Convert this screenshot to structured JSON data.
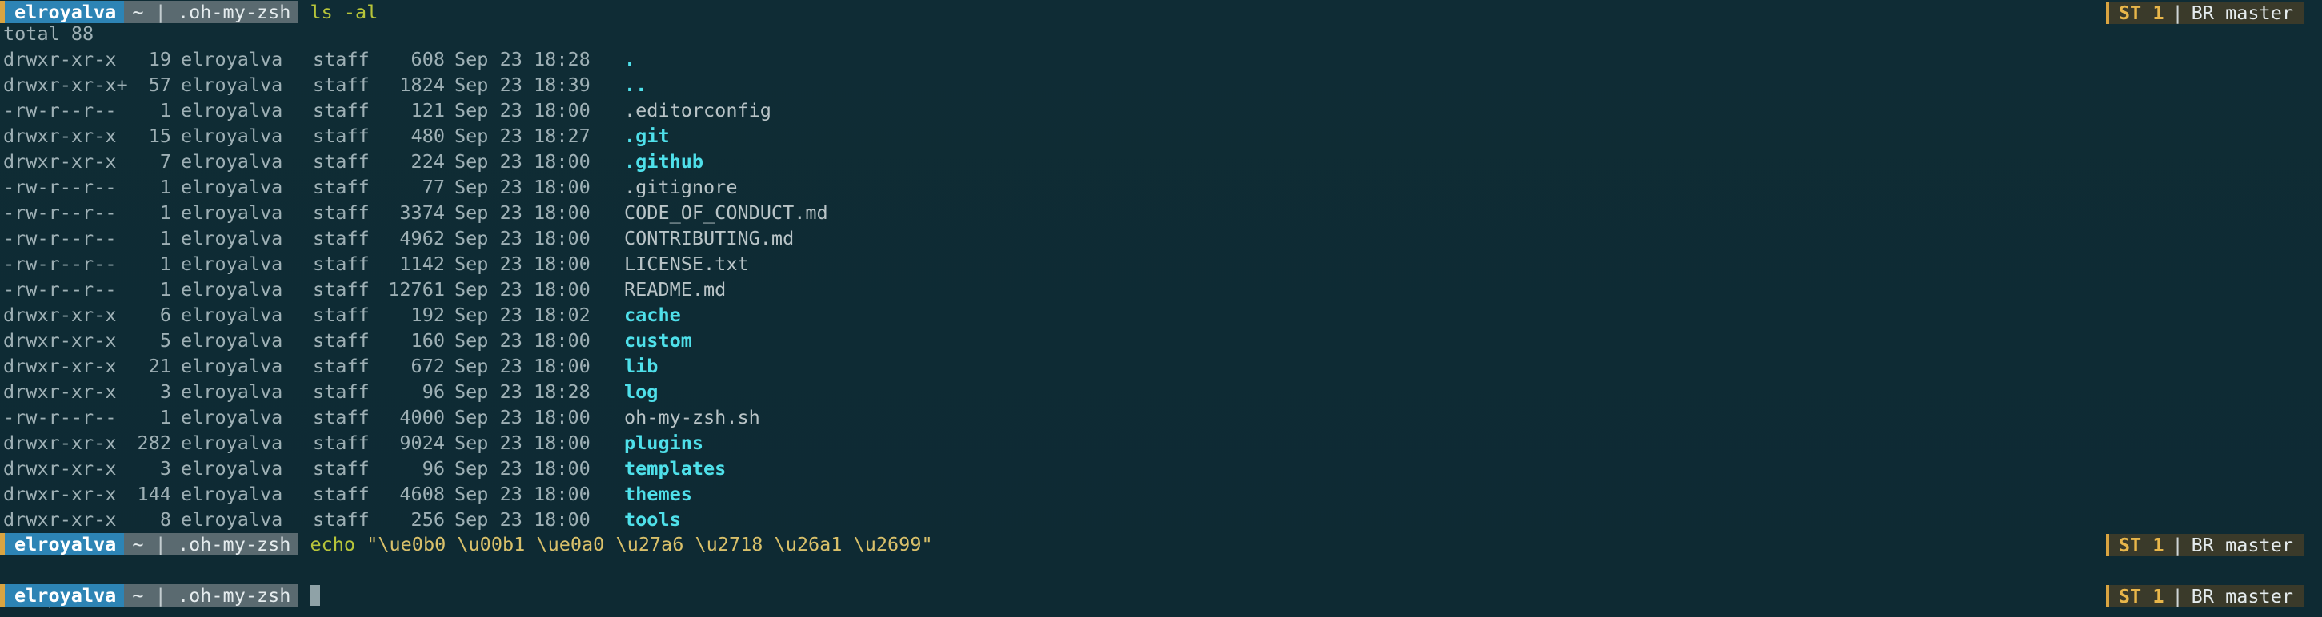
{
  "prompt": {
    "user": "elroyalva",
    "home": "~",
    "separator": "|",
    "dir": ".oh-my-zsh",
    "status_label": "ST 1",
    "branch_label": "BR master"
  },
  "commands": {
    "first": "ls -al",
    "second_cmd": "echo",
    "second_arg": "\"\\ue0b0 \\u00b1 \\ue0a0 \\u27a6 \\u2718 \\u26a1 \\u2699\""
  },
  "total_line": "total 88",
  "listing": [
    {
      "perm": "drwxr-xr-x",
      "links": "19",
      "owner": "elroyalva",
      "group": "staff",
      "size": "608",
      "date": "Sep 23 18:28",
      "name": ".",
      "is_dir": true
    },
    {
      "perm": "drwxr-xr-x+",
      "links": "57",
      "owner": "elroyalva",
      "group": "staff",
      "size": "1824",
      "date": "Sep 23 18:39",
      "name": "..",
      "is_dir": true
    },
    {
      "perm": "-rw-r--r--",
      "links": "1",
      "owner": "elroyalva",
      "group": "staff",
      "size": "121",
      "date": "Sep 23 18:00",
      "name": ".editorconfig",
      "is_dir": false
    },
    {
      "perm": "drwxr-xr-x",
      "links": "15",
      "owner": "elroyalva",
      "group": "staff",
      "size": "480",
      "date": "Sep 23 18:27",
      "name": ".git",
      "is_dir": true
    },
    {
      "perm": "drwxr-xr-x",
      "links": "7",
      "owner": "elroyalva",
      "group": "staff",
      "size": "224",
      "date": "Sep 23 18:00",
      "name": ".github",
      "is_dir": true
    },
    {
      "perm": "-rw-r--r--",
      "links": "1",
      "owner": "elroyalva",
      "group": "staff",
      "size": "77",
      "date": "Sep 23 18:00",
      "name": ".gitignore",
      "is_dir": false
    },
    {
      "perm": "-rw-r--r--",
      "links": "1",
      "owner": "elroyalva",
      "group": "staff",
      "size": "3374",
      "date": "Sep 23 18:00",
      "name": "CODE_OF_CONDUCT.md",
      "is_dir": false
    },
    {
      "perm": "-rw-r--r--",
      "links": "1",
      "owner": "elroyalva",
      "group": "staff",
      "size": "4962",
      "date": "Sep 23 18:00",
      "name": "CONTRIBUTING.md",
      "is_dir": false
    },
    {
      "perm": "-rw-r--r--",
      "links": "1",
      "owner": "elroyalva",
      "group": "staff",
      "size": "1142",
      "date": "Sep 23 18:00",
      "name": "LICENSE.txt",
      "is_dir": false
    },
    {
      "perm": "-rw-r--r--",
      "links": "1",
      "owner": "elroyalva",
      "group": "staff",
      "size": "12761",
      "date": "Sep 23 18:00",
      "name": "README.md",
      "is_dir": false
    },
    {
      "perm": "drwxr-xr-x",
      "links": "6",
      "owner": "elroyalva",
      "group": "staff",
      "size": "192",
      "date": "Sep 23 18:02",
      "name": "cache",
      "is_dir": true
    },
    {
      "perm": "drwxr-xr-x",
      "links": "5",
      "owner": "elroyalva",
      "group": "staff",
      "size": "160",
      "date": "Sep 23 18:00",
      "name": "custom",
      "is_dir": true
    },
    {
      "perm": "drwxr-xr-x",
      "links": "21",
      "owner": "elroyalva",
      "group": "staff",
      "size": "672",
      "date": "Sep 23 18:00",
      "name": "lib",
      "is_dir": true
    },
    {
      "perm": "drwxr-xr-x",
      "links": "3",
      "owner": "elroyalva",
      "group": "staff",
      "size": "96",
      "date": "Sep 23 18:28",
      "name": "log",
      "is_dir": true
    },
    {
      "perm": "-rw-r--r--",
      "links": "1",
      "owner": "elroyalva",
      "group": "staff",
      "size": "4000",
      "date": "Sep 23 18:00",
      "name": "oh-my-zsh.sh",
      "is_dir": false
    },
    {
      "perm": "drwxr-xr-x",
      "links": "282",
      "owner": "elroyalva",
      "group": "staff",
      "size": "9024",
      "date": "Sep 23 18:00",
      "name": "plugins",
      "is_dir": true
    },
    {
      "perm": "drwxr-xr-x",
      "links": "3",
      "owner": "elroyalva",
      "group": "staff",
      "size": "96",
      "date": "Sep 23 18:00",
      "name": "templates",
      "is_dir": true
    },
    {
      "perm": "drwxr-xr-x",
      "links": "144",
      "owner": "elroyalva",
      "group": "staff",
      "size": "4608",
      "date": "Sep 23 18:00",
      "name": "themes",
      "is_dir": true
    },
    {
      "perm": "drwxr-xr-x",
      "links": "8",
      "owner": "elroyalva",
      "group": "staff",
      "size": "256",
      "date": "Sep 23 18:00",
      "name": "tools",
      "is_dir": true
    }
  ],
  "glyph_output": [
    "±",
    "⎇",
    "➦",
    "✘",
    "⚡",
    "⚙"
  ],
  "colors": {
    "background": "#0e2a33",
    "user_segment": "#2d84b5",
    "dir_segment": "#5a6a70",
    "command": "#b7c53a",
    "directory_name": "#4fe0ea",
    "status": "#e8b64a"
  }
}
